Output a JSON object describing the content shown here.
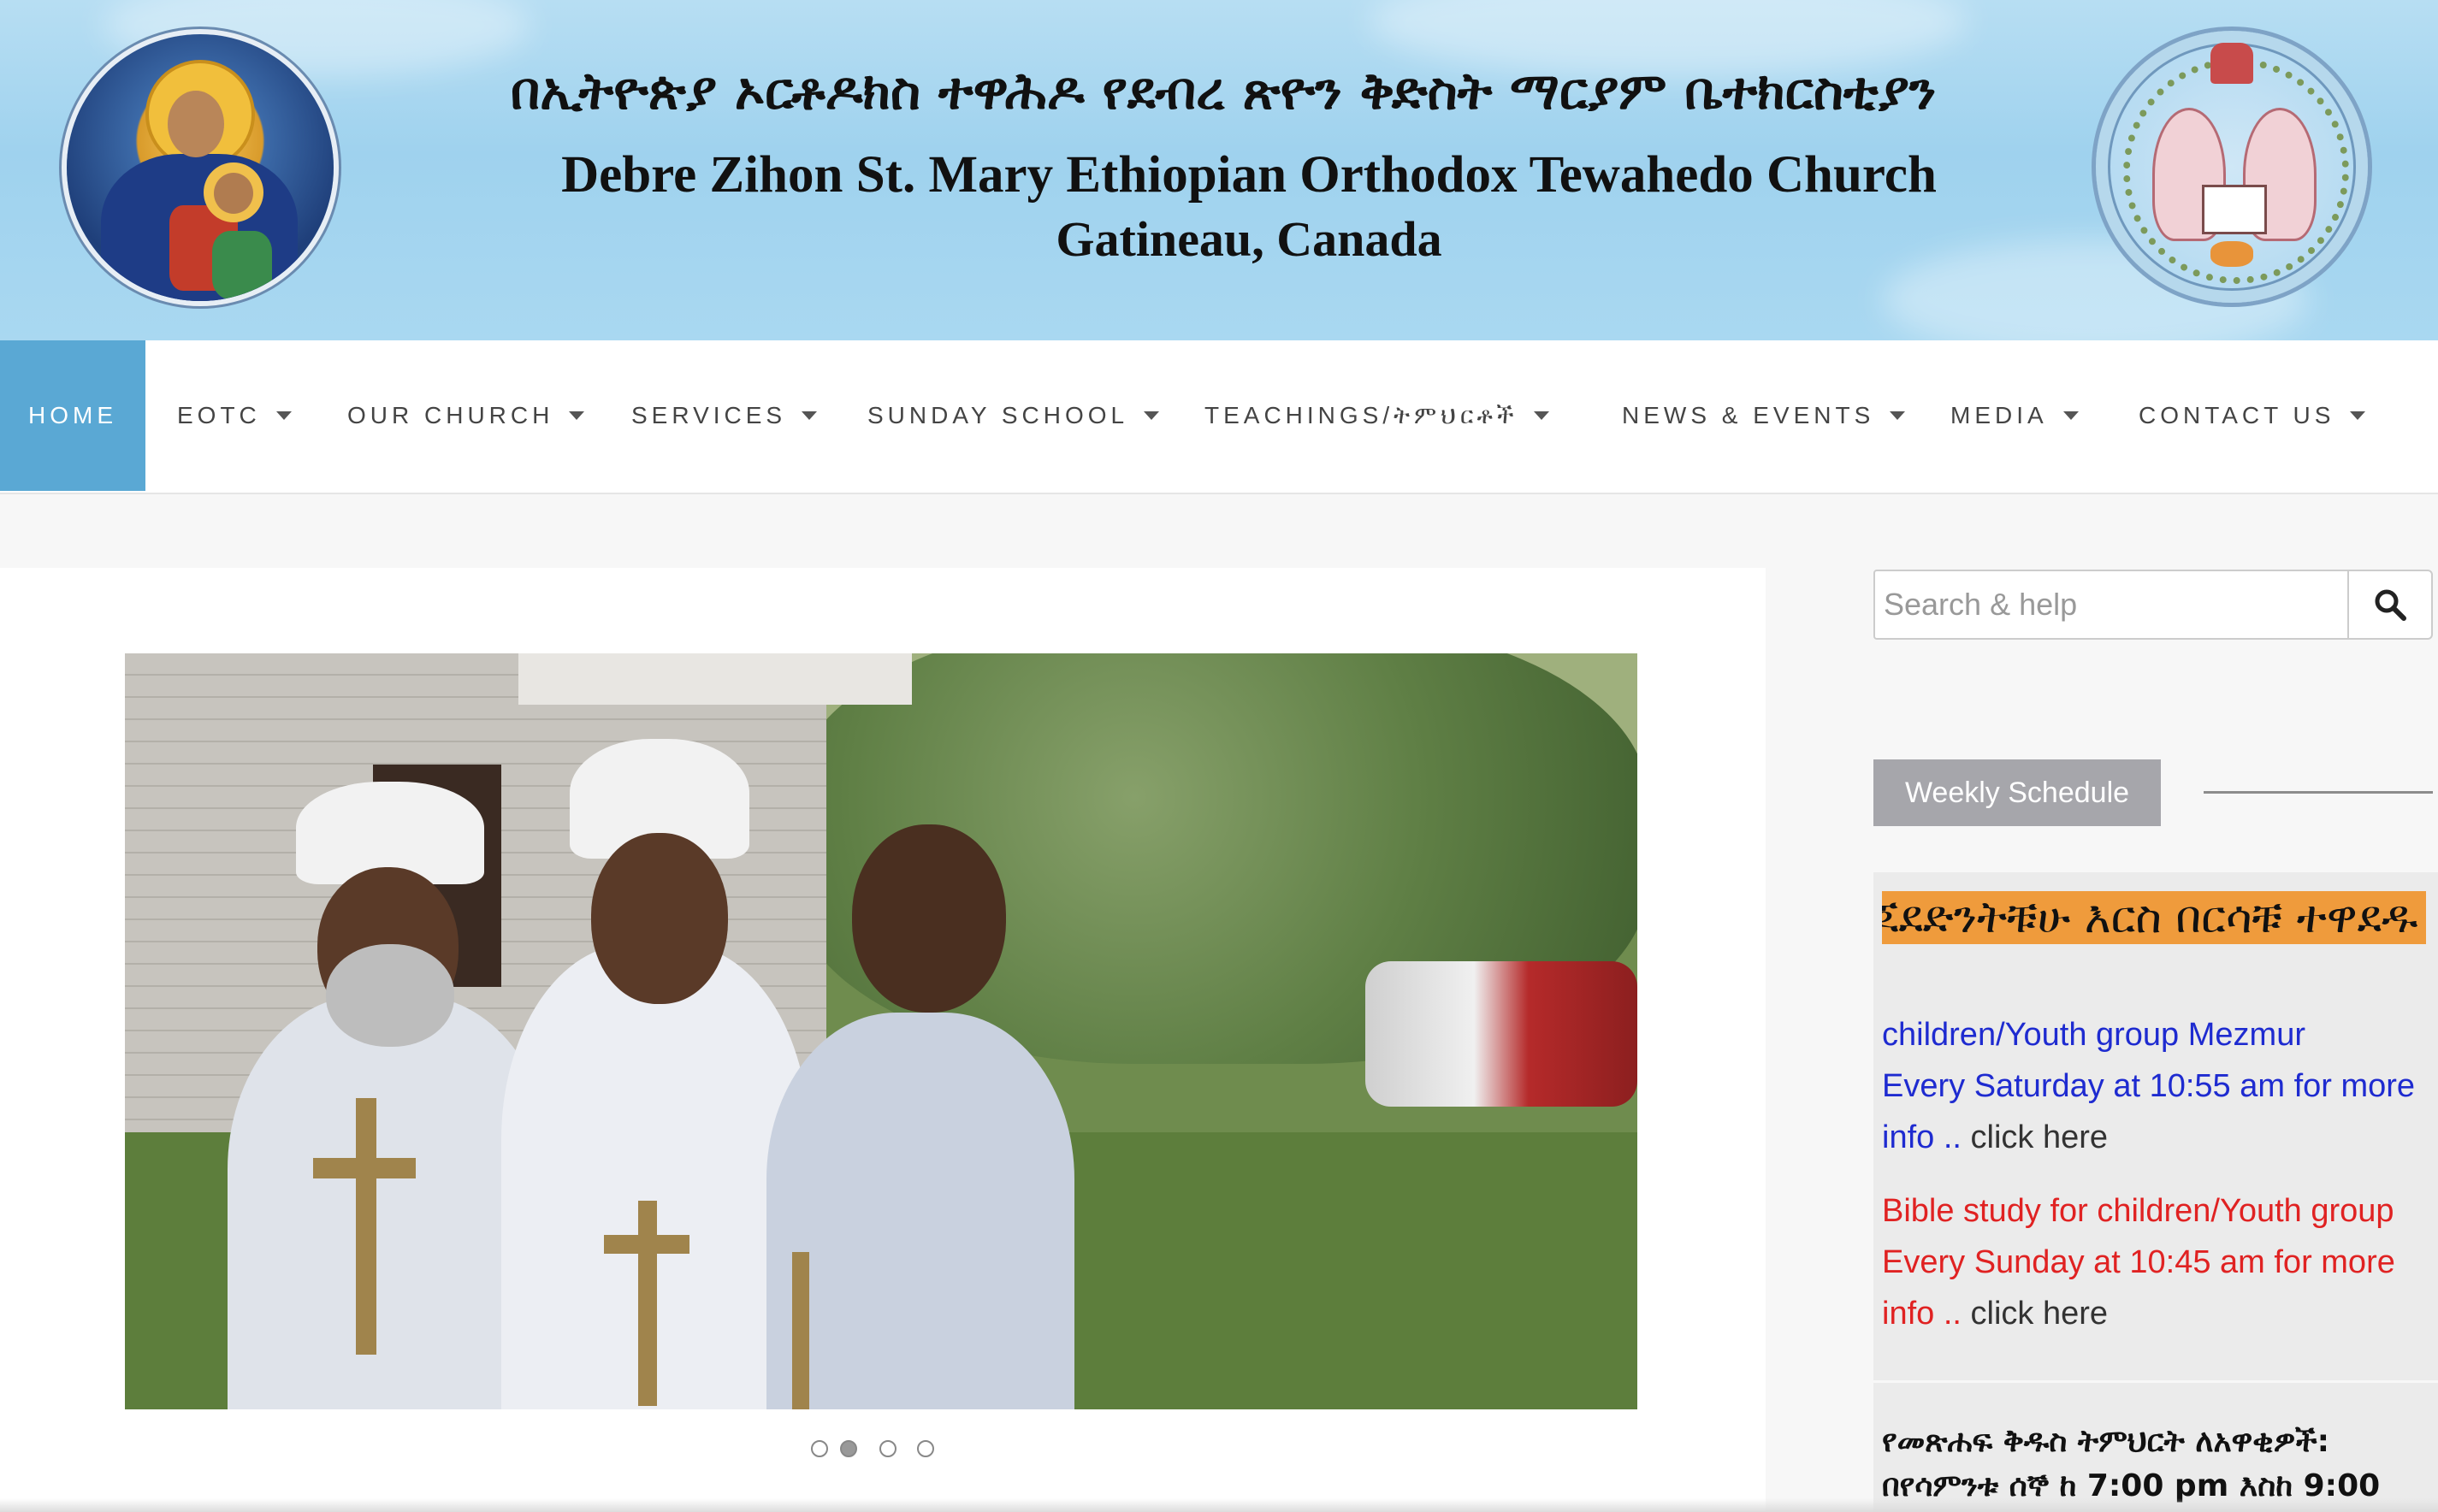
{
  "header": {
    "title_amharic": "በኢትዮጵያ ኦርቶዶክስ ተዋሕዶ የደብረ ጽዮን ቅድስት ማርያም ቤተክርስቲያን",
    "title_english": "Debre Zihon St. Mary Ethiopian Orthodox Tewahedo Church",
    "location": "Gatineau, Canada",
    "left_emblem": "virgin-mary-icon",
    "right_emblem": "church-seal-icon"
  },
  "nav": {
    "items": [
      {
        "label": "HOME",
        "active": true
      },
      {
        "label": "EOTC"
      },
      {
        "label": "OUR CHURCH"
      },
      {
        "label": "SERVICES"
      },
      {
        "label": "SUNDAY SCHOOL"
      },
      {
        "label": "TEACHINGS/ትምህርቶች"
      },
      {
        "label": "NEWS & EVENTS"
      },
      {
        "label": "MEDIA"
      },
      {
        "label": "CONTACT US"
      }
    ],
    "active_color": "#5aa8d4"
  },
  "search": {
    "placeholder": "Search & help",
    "icon": "search-icon"
  },
  "slider": {
    "slides": 4,
    "active_index": 1
  },
  "sidebar": {
    "widget_title": "Weekly Schedule",
    "marquee": "ጆደድንትቹሁ እርስ በርሳቹ ተዋደዱ",
    "item1": {
      "line1": "children/Youth group Mezmur",
      "line2": "Every Saturday at 10:55 am for more",
      "line3a": "info ..",
      "line3b": "click here",
      "color": "#1e2bd0"
    },
    "item2": {
      "line1": "Bible study for children/Youth group",
      "line2": "Every Sunday at 10:45 am for more",
      "line3a": "info ..",
      "line3b": "click here",
      "color": "#e02222"
    },
    "amharic_line1": "የመጽሐፍ ቅዱስ ትምህርት ለአዋቂዎች:",
    "amharic_line2": "በየሳምንቱ ሰኞ ከ 7:00 pm እስከ 9:00"
  }
}
